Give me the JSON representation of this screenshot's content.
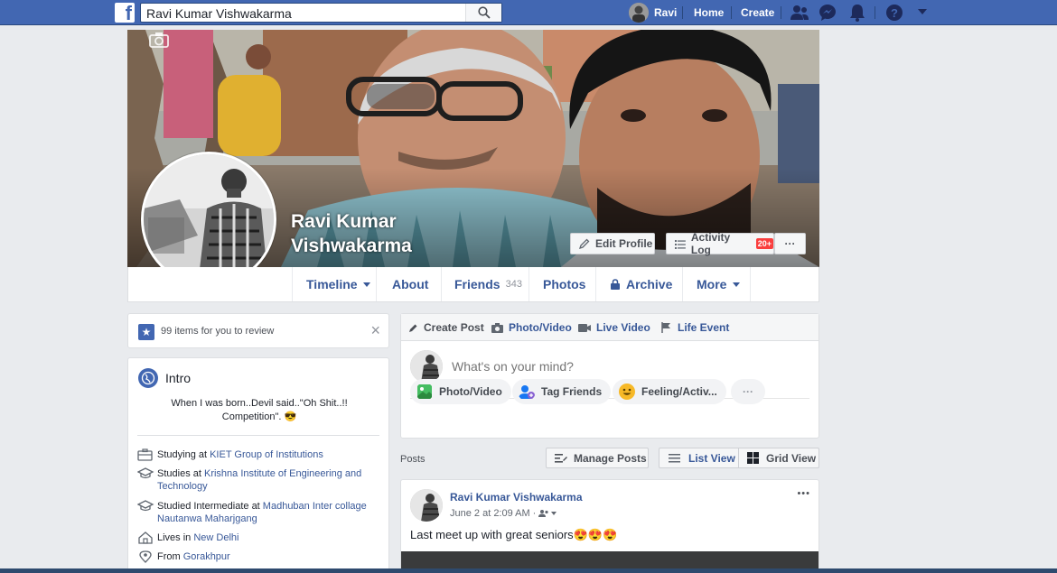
{
  "topbar": {
    "logo": "f",
    "search_value": "Ravi Kumar Vishwakarma",
    "profile_name": "Ravi",
    "home": "Home",
    "create": "Create"
  },
  "cover": {
    "name_line1": "Ravi Kumar",
    "name_line2": "Vishwakarma",
    "edit_profile": "Edit Profile",
    "activity_log": "Activity Log",
    "activity_badge": "20+",
    "more_dots": "···"
  },
  "nav": {
    "timeline": "Timeline",
    "about": "About",
    "friends": "Friends",
    "friends_count": "343",
    "photos": "Photos",
    "archive": "Archive",
    "more": "More"
  },
  "review": {
    "text": "99 items for you to review",
    "close": "×"
  },
  "intro": {
    "title": "Intro",
    "bio_line1": "When I was born..Devil said..\"Oh Shit..!!",
    "bio_line2": "Competition\". 😎",
    "rows": [
      {
        "prefix": "Studying at ",
        "link": "KIET Group of Institutions"
      },
      {
        "prefix": "Studies at ",
        "link": "Krishna Institute of Engineering and Technology"
      },
      {
        "prefix": "Studied Intermediate at ",
        "link": "Madhuban Inter collage Nautanwa Maharjgang"
      },
      {
        "prefix": "Lives in ",
        "link": "New Delhi"
      },
      {
        "prefix": "From ",
        "link": "Gorakhpur"
      }
    ]
  },
  "composer": {
    "create_post": "Create Post",
    "photo_video_tab": "Photo/Video",
    "live_video": "Live Video",
    "life_event": "Life Event",
    "placeholder": "What's on your mind?",
    "photo_video": "Photo/Video",
    "tag_friends": "Tag Friends",
    "feeling": "Feeling/Activ...",
    "more_dots": "···"
  },
  "posts_header": {
    "label": "Posts",
    "manage": "Manage Posts",
    "list_view": "List View",
    "grid_view": "Grid View"
  },
  "post": {
    "author": "Ravi Kumar Vishwakarma",
    "time": "June 2 at 2:09 AM",
    "audience_sep": "·",
    "text": "Last meet up with great seniors😍😍😍",
    "menu": "•••"
  },
  "colors": {
    "brand": "#4267b2",
    "link": "#385898",
    "badge": "#fa3e3e"
  }
}
